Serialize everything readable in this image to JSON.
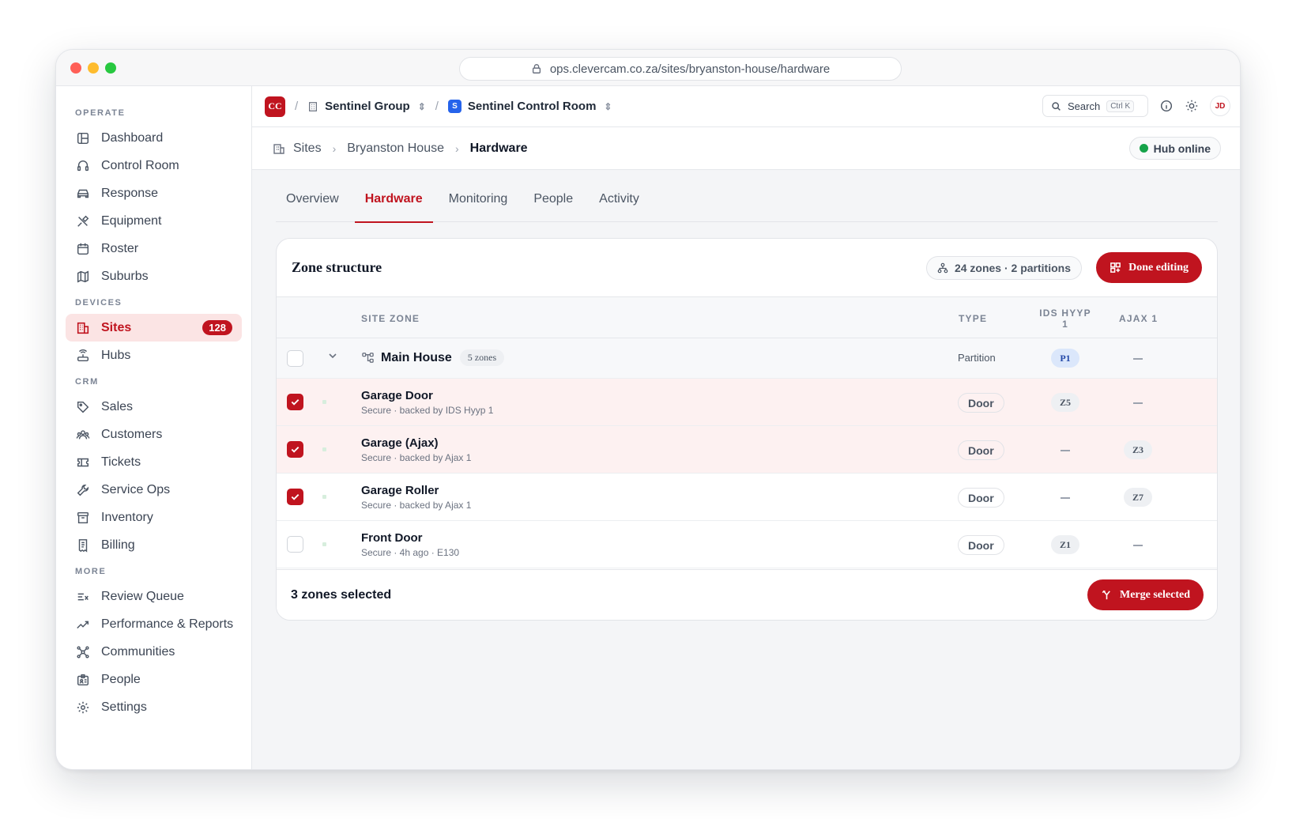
{
  "browser": {
    "url": "ops.clevercam.co.za/sites/bryanston-house/hardware"
  },
  "sidebar": {
    "sections": {
      "operate": "OPERATE",
      "devices": "DEVICES",
      "crm": "CRM",
      "more": "MORE"
    },
    "items": {
      "dashboard": "Dashboard",
      "control_room": "Control Room",
      "response": "Response",
      "equipment": "Equipment",
      "roster": "Roster",
      "suburbs": "Suburbs",
      "sites": "Sites",
      "sites_badge": "128",
      "hubs": "Hubs",
      "sales": "Sales",
      "customers": "Customers",
      "tickets": "Tickets",
      "service_ops": "Service Ops",
      "inventory": "Inventory",
      "billing": "Billing",
      "review_queue": "Review Queue",
      "performance": "Performance & Reports",
      "communities": "Communities",
      "people": "People",
      "settings": "Settings"
    }
  },
  "topbar": {
    "logo": "CC",
    "org": "Sentinel Group",
    "workspace_logo": "S",
    "workspace": "Sentinel Control Room",
    "search_label": "Search",
    "search_shortcut": "Ctrl K",
    "avatar": "JD"
  },
  "breadcrumb": {
    "sites": "Sites",
    "site": "Bryanston House",
    "current": "Hardware",
    "status": "Hub online"
  },
  "tabs": [
    "Overview",
    "Hardware",
    "Monitoring",
    "People",
    "Activity"
  ],
  "card": {
    "title": "Zone structure",
    "summary": "24 zones · 2 partitions",
    "done_label": "Done editing",
    "columns": {
      "zone": "SITE ZONE",
      "type": "TYPE",
      "ids": "IDS HYYP 1",
      "ajax": "AJAX 1"
    },
    "partition": {
      "name": "Main House",
      "count": "5 zones",
      "type": "Partition",
      "ids": "P1"
    },
    "rows": [
      {
        "name": "Garage Door",
        "sub": "Secure · backed by IDS Hyyp 1",
        "type": "Door",
        "ids": "Z5",
        "ajax": ""
      },
      {
        "name": "Garage (Ajax)",
        "sub": "Secure · backed by Ajax 1",
        "type": "Door",
        "ids": "",
        "ajax": "Z3"
      },
      {
        "name": "Garage Roller",
        "sub": "Secure · backed by Ajax 1",
        "type": "Door",
        "ids": "",
        "ajax": "Z7"
      },
      {
        "name": "Front Door",
        "sub": "Secure · 4h ago · E130",
        "type": "Door",
        "ids": "Z1",
        "ajax": ""
      }
    ],
    "selected_text": "3 zones selected",
    "merge_label": "Merge selected"
  },
  "colors": {
    "accent": "#c0141f",
    "online": "#16a34a",
    "partition_chip": "#dbe7fb"
  }
}
